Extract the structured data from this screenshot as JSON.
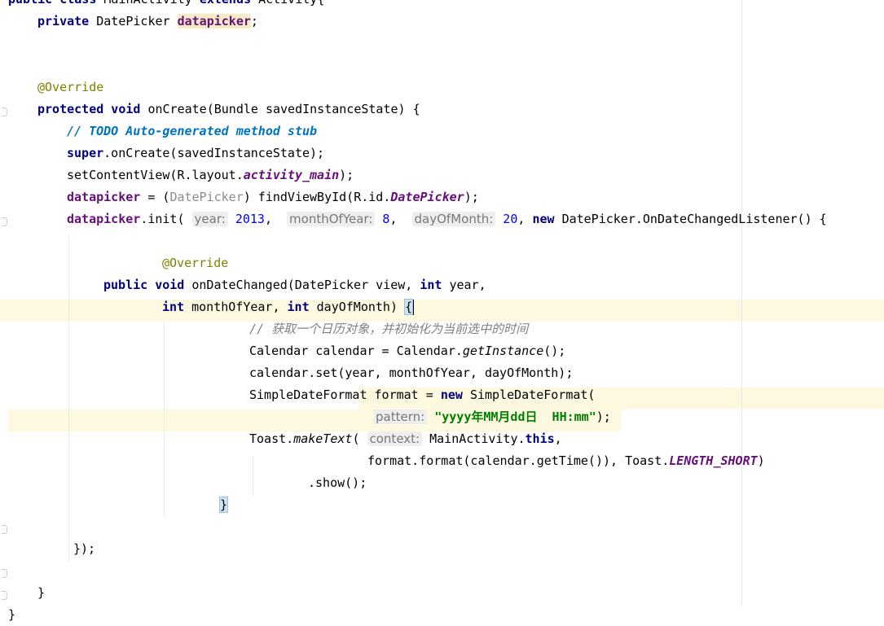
{
  "editor": {
    "lines": [
      {
        "parts": [
          {
            "t": "kw",
            "v": "public class "
          },
          {
            "t": "p",
            "v": "MainActivity "
          },
          {
            "t": "kw",
            "v": "extends "
          },
          {
            "t": "p",
            "v": "Activity{"
          }
        ]
      },
      {
        "parts": [
          {
            "t": "kw",
            "v": "private "
          },
          {
            "t": "p",
            "v": "DatePicker "
          },
          {
            "t": "fldv",
            "v": "datapicker"
          },
          {
            "t": "p",
            "v": ";"
          }
        ]
      },
      {
        "parts": []
      },
      {
        "parts": []
      },
      {
        "parts": [
          {
            "t": "ann",
            "v": "@Override"
          }
        ]
      },
      {
        "parts": [
          {
            "t": "kw",
            "v": "protected void "
          },
          {
            "t": "p",
            "v": "onCreate(Bundle savedInstanceState) {"
          }
        ]
      },
      {
        "parts": [
          {
            "t": "todo",
            "v": "// TODO Auto-generated method stub"
          }
        ]
      },
      {
        "parts": [
          {
            "t": "kw",
            "v": "super"
          },
          {
            "t": "p",
            "v": ".onCreate(savedInstanceState);"
          }
        ]
      },
      {
        "parts": [
          {
            "t": "p",
            "v": "setContentView(R.layout."
          },
          {
            "t": "fldi",
            "v": "activity_main"
          },
          {
            "t": "p",
            "v": ");"
          }
        ]
      },
      {
        "parts": [
          {
            "t": "fld",
            "v": "datapicker"
          },
          {
            "t": "p",
            "v": " = ("
          },
          {
            "t": "cast",
            "v": "DatePicker"
          },
          {
            "t": "p",
            "v": ") findViewById(R.id."
          },
          {
            "t": "fldi",
            "v": "DatePicker"
          },
          {
            "t": "p",
            "v": ");"
          }
        ]
      },
      {
        "parts": [
          {
            "t": "fld",
            "v": "datapicker"
          },
          {
            "t": "p",
            "v": ".init( "
          },
          {
            "t": "hint",
            "v": "year:"
          },
          {
            "t": "num",
            "v": " 2013"
          },
          {
            "t": "p",
            "v": ",  "
          },
          {
            "t": "hint",
            "v": "monthOfYear:"
          },
          {
            "t": "num",
            "v": " 8"
          },
          {
            "t": "p",
            "v": ",  "
          },
          {
            "t": "hint",
            "v": "dayOfMonth:"
          },
          {
            "t": "num",
            "v": " 20"
          },
          {
            "t": "p",
            "v": ", "
          },
          {
            "t": "kw",
            "v": "new "
          },
          {
            "t": "p",
            "v": "DatePicker.OnDateChangedListener() {"
          }
        ]
      },
      {
        "parts": []
      },
      {
        "parts": [
          {
            "t": "ann",
            "v": "@Override"
          }
        ]
      },
      {
        "parts": [
          {
            "t": "kw",
            "v": "public void "
          },
          {
            "t": "p",
            "v": "onDateChanged(DatePicker view, "
          },
          {
            "t": "kw",
            "v": "int "
          },
          {
            "t": "p",
            "v": "year,"
          }
        ]
      },
      {
        "parts": [
          {
            "t": "kw",
            "v": "int "
          },
          {
            "t": "p",
            "v": "monthOfYear, "
          },
          {
            "t": "kw",
            "v": "int "
          },
          {
            "t": "p",
            "v": "dayOfMonth) "
          },
          {
            "t": "brace",
            "v": "{"
          }
        ]
      },
      {
        "parts": [
          {
            "t": "cmt",
            "v": "// 获取一个日历对象，并初始化为当前选中的时间"
          }
        ]
      },
      {
        "parts": [
          {
            "t": "p",
            "v": "Calendar calendar = Calendar."
          },
          {
            "t": "stat",
            "v": "getInstance"
          },
          {
            "t": "p",
            "v": "();"
          }
        ]
      },
      {
        "parts": [
          {
            "t": "p",
            "v": "calendar.set(year, monthOfYear, dayOfMonth);"
          }
        ]
      },
      {
        "parts": [
          {
            "t": "p",
            "v": "SimpleDateFormat format = "
          },
          {
            "t": "kw",
            "v": "new "
          },
          {
            "t": "p",
            "v": "SimpleDateFormat("
          }
        ]
      },
      {
        "parts": [
          {
            "t": "hint",
            "v": "pattern:"
          },
          {
            "t": "str",
            "v": " \"yyyy年MM月dd日  HH:mm\""
          },
          {
            "t": "p",
            "v": ");"
          }
        ]
      },
      {
        "parts": [
          {
            "t": "p",
            "v": "Toast."
          },
          {
            "t": "stat",
            "v": "makeText"
          },
          {
            "t": "p",
            "v": "( "
          },
          {
            "t": "hint",
            "v": "context:"
          },
          {
            "t": "p",
            "v": " MainActivity."
          },
          {
            "t": "kw",
            "v": "this"
          },
          {
            "t": "p",
            "v": ","
          }
        ]
      },
      {
        "parts": [
          {
            "t": "p",
            "v": "format.format(calendar.getTime()), Toast."
          },
          {
            "t": "fldi",
            "v": "LENGTH_SHORT"
          },
          {
            "t": "p",
            "v": ")"
          }
        ]
      },
      {
        "parts": [
          {
            "t": "p",
            "v": ".show();"
          }
        ]
      },
      {
        "parts": [
          {
            "t": "brace",
            "v": "}"
          }
        ]
      },
      {
        "parts": []
      },
      {
        "parts": [
          {
            "t": "p",
            "v": "});"
          }
        ]
      },
      {
        "parts": []
      },
      {
        "parts": [
          {
            "t": "p",
            "v": "}"
          }
        ]
      },
      {
        "parts": [
          {
            "t": "p",
            "v": "}"
          }
        ]
      }
    ]
  }
}
